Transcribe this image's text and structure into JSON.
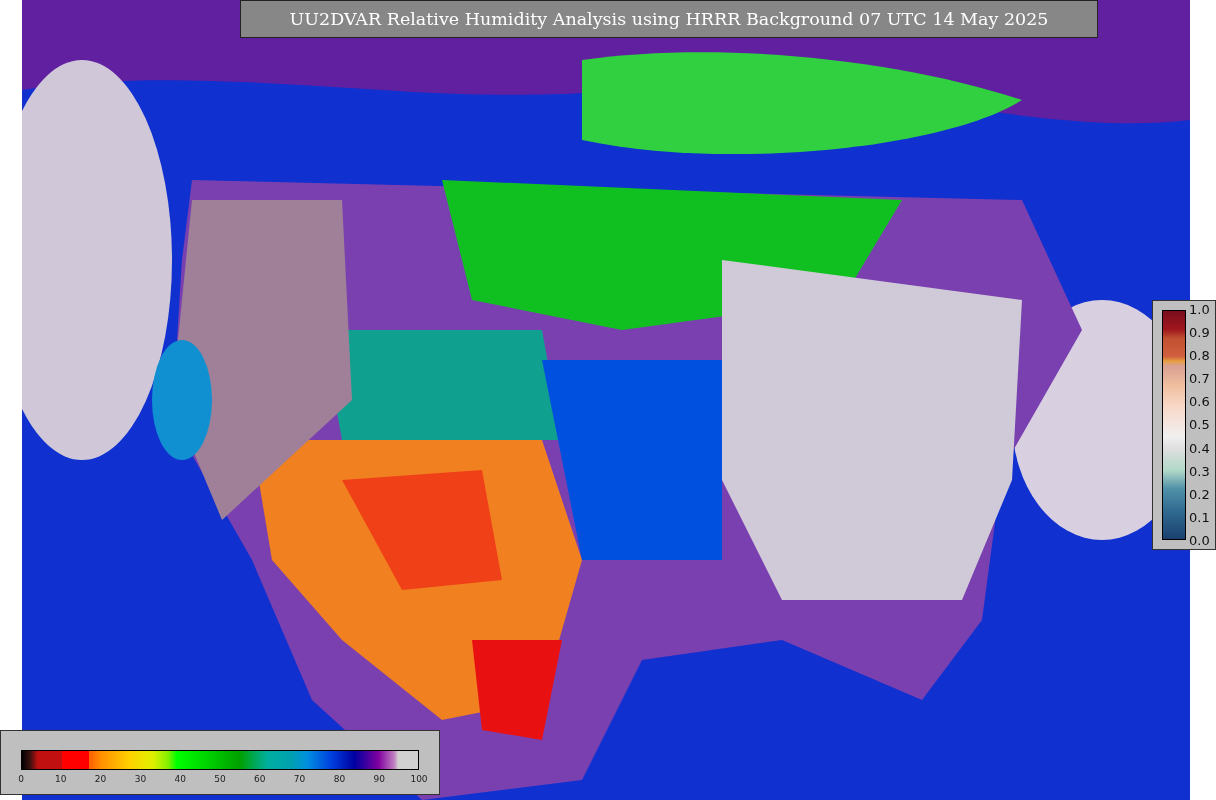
{
  "title": "UU2DVAR Relative Humidity Analysis using HRRR Background 07 UTC 14 May 2025",
  "colorbars": [
    {
      "kind": "horizontal",
      "ticks": [
        "0",
        "10",
        "20",
        "30",
        "40",
        "50",
        "60",
        "70",
        "80",
        "90",
        "100"
      ]
    },
    {
      "kind": "vertical",
      "ticks": [
        "1.0",
        "0.9",
        "0.8",
        "0.7",
        "0.6",
        "0.5",
        "0.4",
        "0.3",
        "0.2",
        "0.1",
        "0.0"
      ]
    }
  ]
}
